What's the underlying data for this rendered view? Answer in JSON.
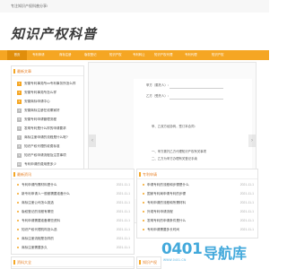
{
  "header": {
    "tagline": "专注知识产权科普分享!",
    "logo": "知识产权科普"
  },
  "nav": {
    "items": [
      {
        "label": "首页",
        "active": true
      },
      {
        "label": "专利申请",
        "active": false
      },
      {
        "label": "商标注册",
        "active": false
      },
      {
        "label": "版权登记",
        "active": false
      },
      {
        "label": "知识产权",
        "active": false
      },
      {
        "label": "专利转让",
        "active": false
      },
      {
        "label": "知识产权代理",
        "active": false
      },
      {
        "label": "专利代理",
        "active": false
      },
      {
        "label": "知识产权",
        "active": false
      }
    ]
  },
  "hot": {
    "title": "最新文章",
    "items": [
      "安徽专利事务所xx专利事务所怎么样",
      "安徽专利事务所怎么样",
      "安徽商标申请中心",
      "安徽商标注册在线哪家好",
      "安徽专利申请管理流程",
      "发明专利是什么样的申请要求",
      "商标注册申请的流程是什么呢?",
      "知识产权代理的收费标准",
      "知识产权申请流程及注意事项",
      "专利申请的费用是多少"
    ]
  },
  "slider": {
    "lines": [
      "甲方（委托人）：",
      "乙方（受托人）：",
      "甲、乙双方经协商，签订本合同：",
      "一、甲方委托乙方代理知识产权有关事项",
      "二、乙方为甲方办理有关登记手续",
      "三、本合同自双方签字之日起生效"
    ]
  },
  "news": {
    "title": "最新资讯",
    "items": [
      {
        "text": "专利申请所需材料是什么",
        "date": "2021-11-1"
      },
      {
        "text": "新专利申请人一般都需要准备什么",
        "date": "2021-11-1"
      },
      {
        "text": "商标注册公司怎么挑选",
        "date": "2021-11-1"
      },
      {
        "text": "版权登记的流程有哪些",
        "date": "2021-11-1"
      },
      {
        "text": "专利申请需要准备哪些资料",
        "date": "2021-11-1"
      },
      {
        "text": "知识产权代理机构怎么选",
        "date": "2021-11-1"
      },
      {
        "text": "商标注册流程是怎样的",
        "date": "2021-11-1"
      },
      {
        "text": "商标注册需要多久",
        "date": "2021-11-1"
      },
      {
        "text": "专利申请收费标准",
        "date": "2021-11-1"
      }
    ]
  },
  "patent": {
    "title": "专利申请",
    "items": [
      {
        "text": "申请专利的流程和步骤是什么",
        "date": "2021-11-1"
      },
      {
        "text": "国家专利局申请专利的步骤",
        "date": "2021-11-1"
      },
      {
        "text": "专利申请的流程和所需材料",
        "date": "2021-11-1"
      },
      {
        "text": "外观专利申请流程",
        "date": "2021-11-1"
      },
      {
        "text": "发明专利的申请条件是什么",
        "date": "2021-11-1"
      },
      {
        "text": "专利申请需要多长时间",
        "date": "2021-11-1"
      },
      {
        "text": "实用新型专利和发明专利的区别",
        "date": "2021-11-1"
      },
      {
        "text": "专利申请费用一般是多少钱",
        "date": "2021-11-1"
      },
      {
        "text": "专利申请的注意事项",
        "date": "2021-11-1"
      }
    ]
  },
  "bottom": {
    "left_title": "资料大全",
    "right_title": "知识产权"
  },
  "watermark": {
    "digits": "0401",
    "text": "导航库",
    "url": "WWW.0401.CN"
  },
  "colors": {
    "accent": "#f5a623",
    "watermark": "#2fa0d8"
  }
}
